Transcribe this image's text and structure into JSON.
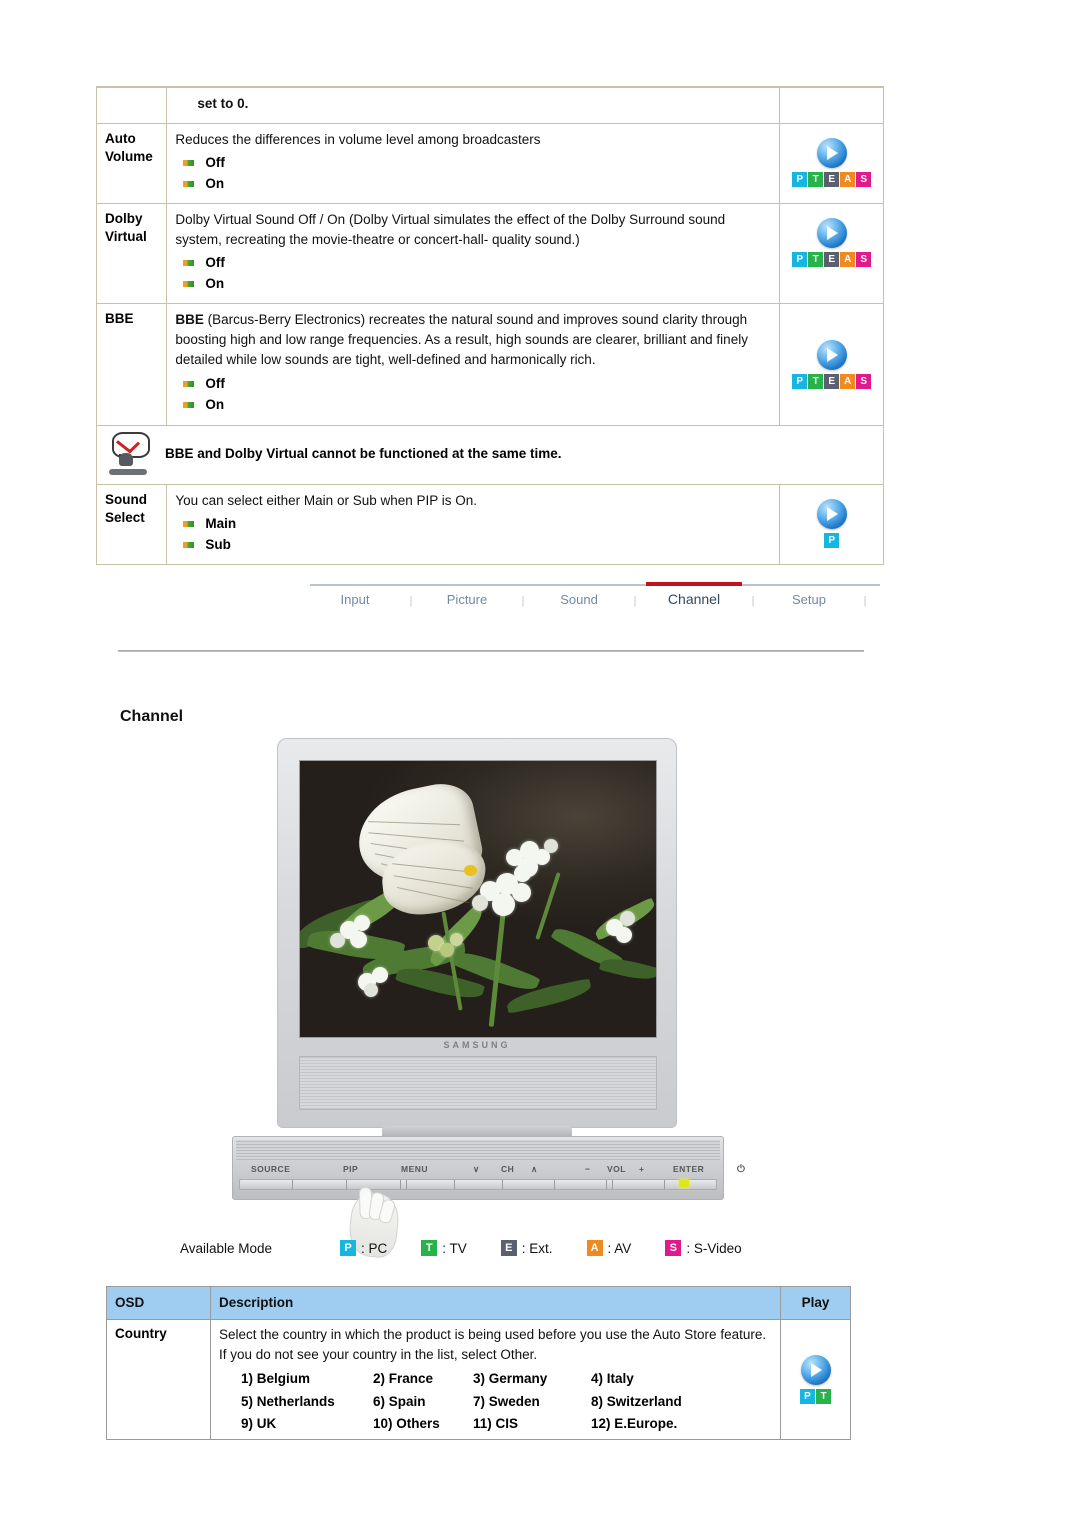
{
  "sound_table": {
    "partial_row": {
      "description": "set to 0."
    },
    "rows": [
      {
        "osd": "Auto Volume",
        "osd_lines": [
          "Auto",
          "Volume"
        ],
        "description": "Reduces the differences in volume level among broadcasters",
        "options": [
          "Off",
          "On"
        ],
        "play": {
          "orb": "play-icon",
          "badges": [
            "P",
            "T",
            "E",
            "A",
            "S"
          ]
        }
      },
      {
        "osd": "Dolby Virtual",
        "osd_lines": [
          "Dolby",
          "Virtual"
        ],
        "description": "Dolby Virtual Sound Off / On (Dolby Virtual simulates the effect of the Dolby Surround sound system, recreating the movie-theatre or concert-hall- quality sound.)",
        "options": [
          "Off",
          "On"
        ],
        "play": {
          "orb": "play-icon",
          "badges": [
            "P",
            "T",
            "E",
            "A",
            "S"
          ]
        }
      },
      {
        "osd": "BBE",
        "osd_lines": [
          "BBE"
        ],
        "description_bold": "BBE",
        "description": " (Barcus-Berry Electronics) recreates the natural sound and improves sound clarity through boosting high and low range frequencies. As a result, high sounds are clearer, brilliant and finely detailed while low sounds are tight, well-defined and harmonically rich.",
        "options": [
          "Off",
          "On"
        ],
        "play": {
          "orb": "play-icon",
          "badges": [
            "P",
            "T",
            "E",
            "A",
            "S"
          ]
        }
      }
    ],
    "note": {
      "icon": "note-icon",
      "text": "BBE and Dolby Virtual cannot be functioned at the same time."
    },
    "sound_select": {
      "osd": "Sound Select",
      "osd_lines": [
        "Sound",
        "Select"
      ],
      "description": "You can select either Main or Sub when PIP is On.",
      "options": [
        "Main",
        "Sub"
      ],
      "play": {
        "orb": "play-icon",
        "badges": [
          "P"
        ]
      }
    }
  },
  "nav": {
    "tabs": [
      {
        "label": "Input",
        "active": false
      },
      {
        "label": "Picture",
        "active": false
      },
      {
        "label": "Sound",
        "active": false
      },
      {
        "label": "Channel",
        "active": true
      },
      {
        "label": "Setup",
        "active": false
      }
    ],
    "separator": "|",
    "active_color": "#c1121f"
  },
  "section": {
    "title": "Channel"
  },
  "monitor": {
    "brand": "SAMSUNG",
    "controls": [
      "SOURCE",
      "PIP",
      "MENU",
      "CH",
      "VOL",
      "ENTER"
    ],
    "ch_down": "∨",
    "ch_up": "∧",
    "vol_minus": "−",
    "vol_plus": "+",
    "power": "⏻",
    "screen_content": "butterfly-on-white-flowers-photo"
  },
  "available_mode": {
    "title": "Available Mode",
    "items": [
      {
        "badge": "P",
        "label": ": PC",
        "color": "#17b6e0"
      },
      {
        "badge": "T",
        "label": ": TV",
        "color": "#27b34a"
      },
      {
        "badge": "E",
        "label": ": Ext.",
        "color": "#5b6070"
      },
      {
        "badge": "A",
        "label": ": AV",
        "color": "#f08a1e"
      },
      {
        "badge": "S",
        "label": ": S-Video",
        "color": "#e0198c"
      }
    ]
  },
  "osd_table": {
    "headers": [
      "OSD",
      "Description",
      "Play"
    ],
    "rows": [
      {
        "osd": "Country",
        "description": "Select the country in which the product is being used before you use the Auto Store feature. If you do not see your country in the list, select Other.",
        "countries": [
          "1) Belgium",
          "2) France",
          "3) Germany",
          "4) Italy",
          "5) Netherlands",
          "6) Spain",
          "7) Sweden",
          "8) Switzerland",
          "9) UK",
          "10) Others",
          "11) CIS",
          "12) E.Europe."
        ],
        "play": {
          "orb": "play-icon",
          "badges": [
            "P",
            "T"
          ]
        }
      }
    ]
  },
  "colors": {
    "header_blue": "#9fcdf2",
    "table_border": "#c9c2a8",
    "osd_border": "#9a9a9a",
    "tab_text": "#6f8aa5",
    "tab_active_text": "#2f4a63",
    "accent_red": "#c1121f"
  }
}
